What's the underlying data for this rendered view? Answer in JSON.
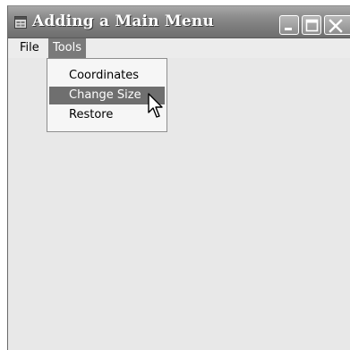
{
  "window": {
    "title": "Adding a Main Menu",
    "app_icon": "form-window-icon",
    "caption_buttons": [
      "minimize-icon",
      "maximize-icon",
      "close-icon"
    ]
  },
  "menubar": {
    "items": [
      {
        "label": "File"
      },
      {
        "label": "Tools",
        "state": "open"
      }
    ]
  },
  "dropdown": {
    "items": [
      {
        "label": "Coordinates"
      },
      {
        "label": "Change Size",
        "state": "highlighted"
      },
      {
        "label": "Restore"
      }
    ]
  },
  "colors": {
    "titlebar": "#8c8c8c",
    "highlight": "#6f6f6f",
    "client_area": "#e8e8e8"
  },
  "cursor": "arrow-pointer-icon"
}
